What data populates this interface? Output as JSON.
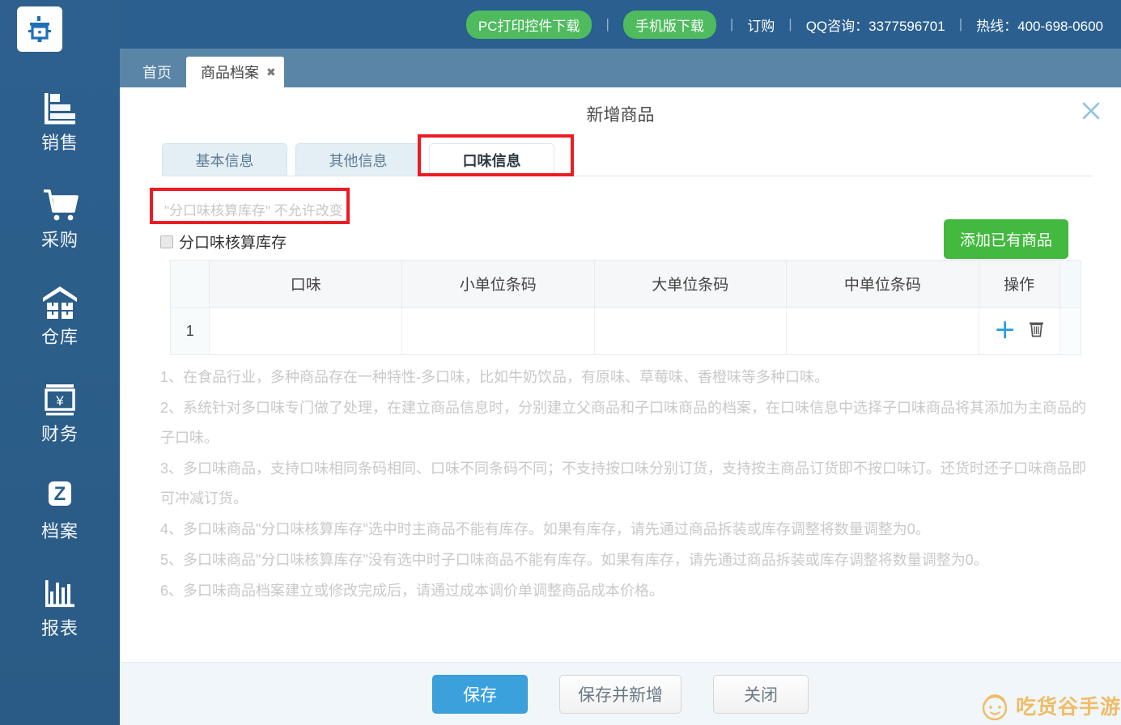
{
  "topbar": {
    "items": [
      {
        "type": "pill",
        "label": "PC打印控件下载",
        "name": "pc-print-plugin-download"
      },
      {
        "type": "sep",
        "label": "|"
      },
      {
        "type": "pill",
        "label": "手机版下载",
        "name": "mobile-version-download"
      },
      {
        "type": "sep",
        "label": "|"
      },
      {
        "type": "link",
        "label": "订购",
        "name": "order"
      },
      {
        "type": "sep",
        "label": "|"
      },
      {
        "type": "text",
        "label": "QQ咨询：3377596701",
        "name": "qq-consult"
      },
      {
        "type": "sep",
        "label": "|"
      },
      {
        "type": "text",
        "label": "热线：400-698-0600",
        "name": "hotline"
      }
    ],
    "pill_color": "#4fbb5e",
    "bar_color": "#2a5f8f"
  },
  "sidebar": {
    "logo_name": "app-logo",
    "items": [
      {
        "label": "销售",
        "icon": "sales-chart-icon"
      },
      {
        "label": "采购",
        "icon": "shopping-cart-icon"
      },
      {
        "label": "仓库",
        "icon": "warehouse-icon"
      },
      {
        "label": "财务",
        "icon": "finance-yuan-icon"
      },
      {
        "label": "档案",
        "icon": "archive-z-icon"
      },
      {
        "label": "报表",
        "icon": "report-bars-icon"
      }
    ]
  },
  "browser_tabs": [
    {
      "label": "首页",
      "active": false,
      "closable": false
    },
    {
      "label": "商品档案",
      "active": true,
      "closable": true,
      "close_glyph": "✖"
    }
  ],
  "dialog": {
    "title": "新增商品",
    "close_glyph": "✕",
    "tabs": [
      {
        "label": "基本信息",
        "active": false
      },
      {
        "label": "其他信息",
        "active": false
      },
      {
        "label": "口味信息",
        "active": true
      }
    ],
    "note_top": "\"分口味核算库存\" 不允许改变",
    "checkbox_label": "分口味核算库存",
    "checkbox_checked": false,
    "add_existing_button": "添加已有商品",
    "add_existing_color": "#43b93f"
  },
  "table": {
    "headers": [
      "",
      "口味",
      "小单位条码",
      "大单位条码",
      "中单位条码",
      "操作",
      ""
    ],
    "rows": [
      {
        "index": "1",
        "flavor": "",
        "small_unit_barcode": "",
        "large_unit_barcode": "",
        "medium_unit_barcode": "",
        "ops": [
          "add-row-icon",
          "delete-row-icon"
        ]
      }
    ],
    "op_plus_glyph": "＋",
    "op_plus_color": "#2c9fe0"
  },
  "instructions": [
    "1、在食品行业，多种商品存在一种特性-多口味，比如牛奶饮品，有原味、草莓味、香橙味等多种口味。",
    "2、系统针对多口味专门做了处理，在建立商品信息时，分别建立父商品和子口味商品的档案，在口味信息中选择子口味商品将其添加为主商品的子口味。",
    "3、多口味商品，支持口味相同条码相同、口味不同条码不同；不支持按口味分别订货，支持按主商品订货即不按口味订。还货时还子口味商品即可冲减订货。",
    "4、多口味商品\"分口味核算库存\"选中时主商品不能有库存。如果有库存，请先通过商品拆装或库存调整将数量调整为0。",
    "5、多口味商品\"分口味核算库存\"没有选中时子口味商品不能有库存。如果有库存，请先通过商品拆装或库存调整将数量调整为0。",
    "6、多口味商品档案建立或修改完成后，请通过成本调价单调整商品成本价格。"
  ],
  "footer": {
    "save": "保存",
    "save_and_new": "保存并新增",
    "close": "关闭",
    "primary_color": "#3ba1dd"
  },
  "watermark": {
    "text": "吃货谷手游",
    "color": "#f0a72e"
  }
}
